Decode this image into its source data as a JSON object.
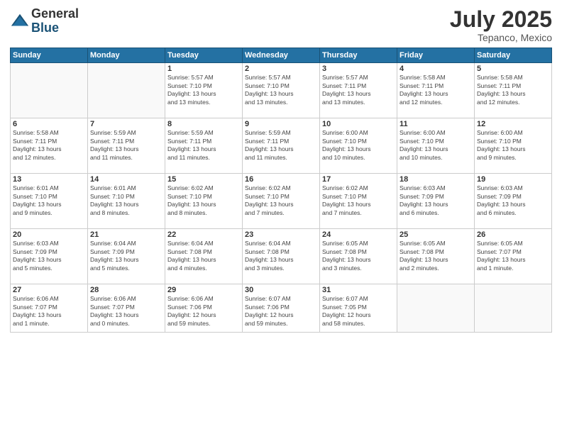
{
  "logo": {
    "general": "General",
    "blue": "Blue"
  },
  "header": {
    "month": "July 2025",
    "location": "Tepanco, Mexico"
  },
  "weekdays": [
    "Sunday",
    "Monday",
    "Tuesday",
    "Wednesday",
    "Thursday",
    "Friday",
    "Saturday"
  ],
  "weeks": [
    [
      {
        "day": "",
        "info": ""
      },
      {
        "day": "",
        "info": ""
      },
      {
        "day": "1",
        "info": "Sunrise: 5:57 AM\nSunset: 7:10 PM\nDaylight: 13 hours\nand 13 minutes."
      },
      {
        "day": "2",
        "info": "Sunrise: 5:57 AM\nSunset: 7:10 PM\nDaylight: 13 hours\nand 13 minutes."
      },
      {
        "day": "3",
        "info": "Sunrise: 5:57 AM\nSunset: 7:11 PM\nDaylight: 13 hours\nand 13 minutes."
      },
      {
        "day": "4",
        "info": "Sunrise: 5:58 AM\nSunset: 7:11 PM\nDaylight: 13 hours\nand 12 minutes."
      },
      {
        "day": "5",
        "info": "Sunrise: 5:58 AM\nSunset: 7:11 PM\nDaylight: 13 hours\nand 12 minutes."
      }
    ],
    [
      {
        "day": "6",
        "info": "Sunrise: 5:58 AM\nSunset: 7:11 PM\nDaylight: 13 hours\nand 12 minutes."
      },
      {
        "day": "7",
        "info": "Sunrise: 5:59 AM\nSunset: 7:11 PM\nDaylight: 13 hours\nand 11 minutes."
      },
      {
        "day": "8",
        "info": "Sunrise: 5:59 AM\nSunset: 7:11 PM\nDaylight: 13 hours\nand 11 minutes."
      },
      {
        "day": "9",
        "info": "Sunrise: 5:59 AM\nSunset: 7:11 PM\nDaylight: 13 hours\nand 11 minutes."
      },
      {
        "day": "10",
        "info": "Sunrise: 6:00 AM\nSunset: 7:10 PM\nDaylight: 13 hours\nand 10 minutes."
      },
      {
        "day": "11",
        "info": "Sunrise: 6:00 AM\nSunset: 7:10 PM\nDaylight: 13 hours\nand 10 minutes."
      },
      {
        "day": "12",
        "info": "Sunrise: 6:00 AM\nSunset: 7:10 PM\nDaylight: 13 hours\nand 9 minutes."
      }
    ],
    [
      {
        "day": "13",
        "info": "Sunrise: 6:01 AM\nSunset: 7:10 PM\nDaylight: 13 hours\nand 9 minutes."
      },
      {
        "day": "14",
        "info": "Sunrise: 6:01 AM\nSunset: 7:10 PM\nDaylight: 13 hours\nand 8 minutes."
      },
      {
        "day": "15",
        "info": "Sunrise: 6:02 AM\nSunset: 7:10 PM\nDaylight: 13 hours\nand 8 minutes."
      },
      {
        "day": "16",
        "info": "Sunrise: 6:02 AM\nSunset: 7:10 PM\nDaylight: 13 hours\nand 7 minutes."
      },
      {
        "day": "17",
        "info": "Sunrise: 6:02 AM\nSunset: 7:10 PM\nDaylight: 13 hours\nand 7 minutes."
      },
      {
        "day": "18",
        "info": "Sunrise: 6:03 AM\nSunset: 7:09 PM\nDaylight: 13 hours\nand 6 minutes."
      },
      {
        "day": "19",
        "info": "Sunrise: 6:03 AM\nSunset: 7:09 PM\nDaylight: 13 hours\nand 6 minutes."
      }
    ],
    [
      {
        "day": "20",
        "info": "Sunrise: 6:03 AM\nSunset: 7:09 PM\nDaylight: 13 hours\nand 5 minutes."
      },
      {
        "day": "21",
        "info": "Sunrise: 6:04 AM\nSunset: 7:09 PM\nDaylight: 13 hours\nand 5 minutes."
      },
      {
        "day": "22",
        "info": "Sunrise: 6:04 AM\nSunset: 7:08 PM\nDaylight: 13 hours\nand 4 minutes."
      },
      {
        "day": "23",
        "info": "Sunrise: 6:04 AM\nSunset: 7:08 PM\nDaylight: 13 hours\nand 3 minutes."
      },
      {
        "day": "24",
        "info": "Sunrise: 6:05 AM\nSunset: 7:08 PM\nDaylight: 13 hours\nand 3 minutes."
      },
      {
        "day": "25",
        "info": "Sunrise: 6:05 AM\nSunset: 7:08 PM\nDaylight: 13 hours\nand 2 minutes."
      },
      {
        "day": "26",
        "info": "Sunrise: 6:05 AM\nSunset: 7:07 PM\nDaylight: 13 hours\nand 1 minute."
      }
    ],
    [
      {
        "day": "27",
        "info": "Sunrise: 6:06 AM\nSunset: 7:07 PM\nDaylight: 13 hours\nand 1 minute."
      },
      {
        "day": "28",
        "info": "Sunrise: 6:06 AM\nSunset: 7:07 PM\nDaylight: 13 hours\nand 0 minutes."
      },
      {
        "day": "29",
        "info": "Sunrise: 6:06 AM\nSunset: 7:06 PM\nDaylight: 12 hours\nand 59 minutes."
      },
      {
        "day": "30",
        "info": "Sunrise: 6:07 AM\nSunset: 7:06 PM\nDaylight: 12 hours\nand 59 minutes."
      },
      {
        "day": "31",
        "info": "Sunrise: 6:07 AM\nSunset: 7:05 PM\nDaylight: 12 hours\nand 58 minutes."
      },
      {
        "day": "",
        "info": ""
      },
      {
        "day": "",
        "info": ""
      }
    ]
  ]
}
